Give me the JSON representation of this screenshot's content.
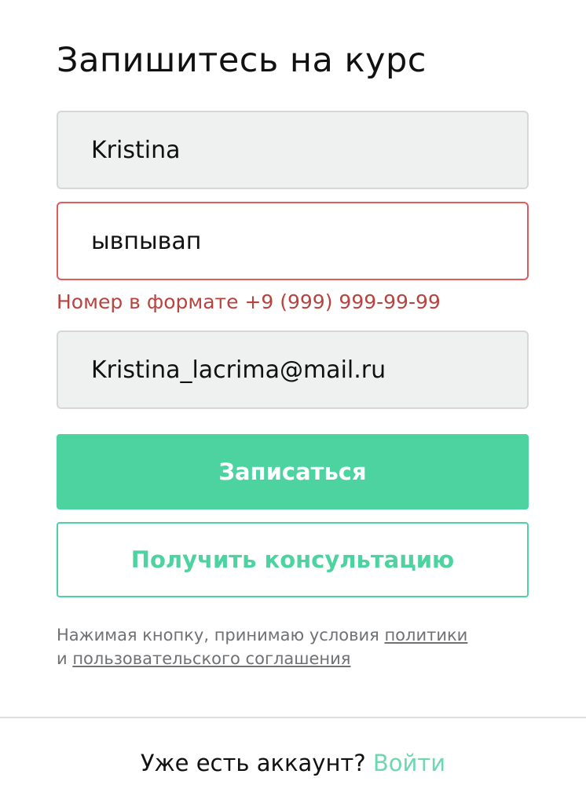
{
  "header": {
    "title": "Запишитесь на курс"
  },
  "form": {
    "name_value": "Kristina",
    "phone_value": "ывпывап",
    "phone_error": "Номер в формате +9 (999) 999-99-99",
    "email_value": "Kristina_lacrima@mail.ru",
    "submit_label": "Записаться",
    "consult_label": "Получить консультацию"
  },
  "legal": {
    "prefix": "Нажимая кнопку, принимаю условия ",
    "policy_link": "политики",
    "and": "и ",
    "agreement_link": "пользовательского соглашения"
  },
  "footer": {
    "question": "Уже есть аккаунт? ",
    "login_link": "Войти"
  },
  "colors": {
    "accent": "#4cd39f",
    "error": "#b9433f",
    "error_border": "#e05a5e",
    "field_bg": "#eff1f0"
  }
}
